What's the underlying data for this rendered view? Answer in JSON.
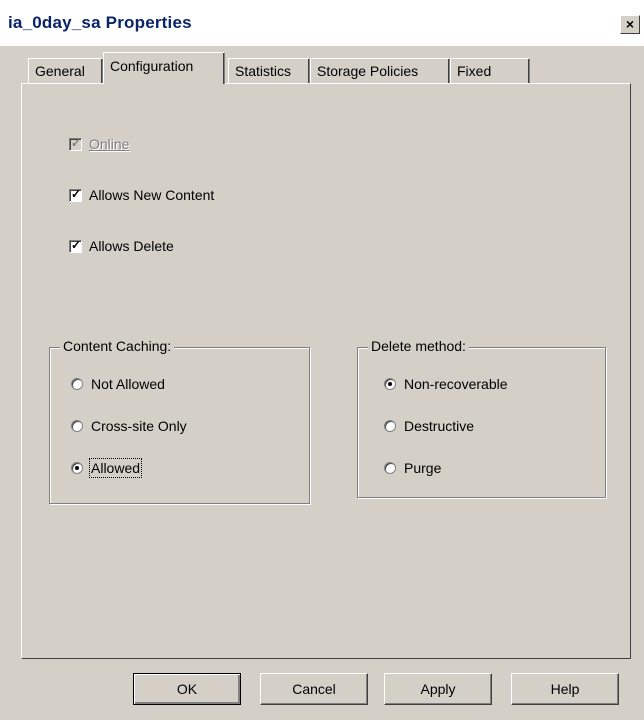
{
  "window": {
    "title": "ia_0day_sa Properties",
    "close_glyph": "×"
  },
  "tabs": [
    {
      "label": "General",
      "active": false
    },
    {
      "label": "Configuration",
      "active": true
    },
    {
      "label": "Statistics",
      "active": false
    },
    {
      "label": "Storage Policies",
      "active": false
    },
    {
      "label": "Fixed",
      "active": false
    }
  ],
  "options": {
    "online": {
      "label": "Online",
      "checked": true,
      "enabled": false
    },
    "allows_new_content": {
      "label": "Allows New Content",
      "checked": true,
      "enabled": true
    },
    "allows_delete": {
      "label": "Allows Delete",
      "checked": true,
      "enabled": true
    }
  },
  "content_caching": {
    "legend": "Content Caching:",
    "options": [
      "Not Allowed",
      "Cross-site Only",
      "Allowed"
    ],
    "selected": "Allowed"
  },
  "delete_method": {
    "legend": "Delete method:",
    "options": [
      "Non-recoverable",
      "Destructive",
      "Purge"
    ],
    "selected": "Non-recoverable"
  },
  "buttons": {
    "ok": "OK",
    "cancel": "Cancel",
    "apply": "Apply",
    "help": "Help"
  }
}
